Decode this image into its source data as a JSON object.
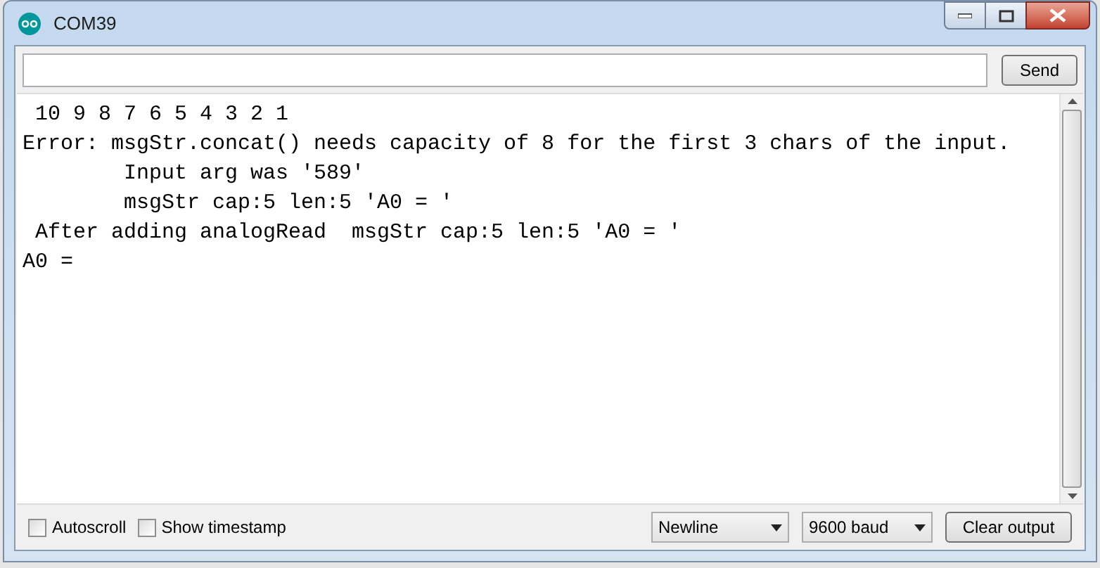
{
  "window": {
    "title": "COM39"
  },
  "send_button": "Send",
  "output_lines": [
    " 10 9 8 7 6 5 4 3 2 1",
    "Error: msgStr.concat() needs capacity of 8 for the first 3 chars of the input.",
    "        Input arg was '589'",
    "        msgStr cap:5 len:5 'A0 = '",
    " After adding analogRead  msgStr cap:5 len:5 'A0 = '",
    "A0 = "
  ],
  "options": [
    {
      "label": "Autoscroll",
      "checked": false
    },
    {
      "label": "Show timestamp",
      "checked": false
    }
  ],
  "line_ending": {
    "value": "Newline"
  },
  "baud_rate": {
    "value": "9600 baud"
  },
  "clear_button": "Clear output"
}
